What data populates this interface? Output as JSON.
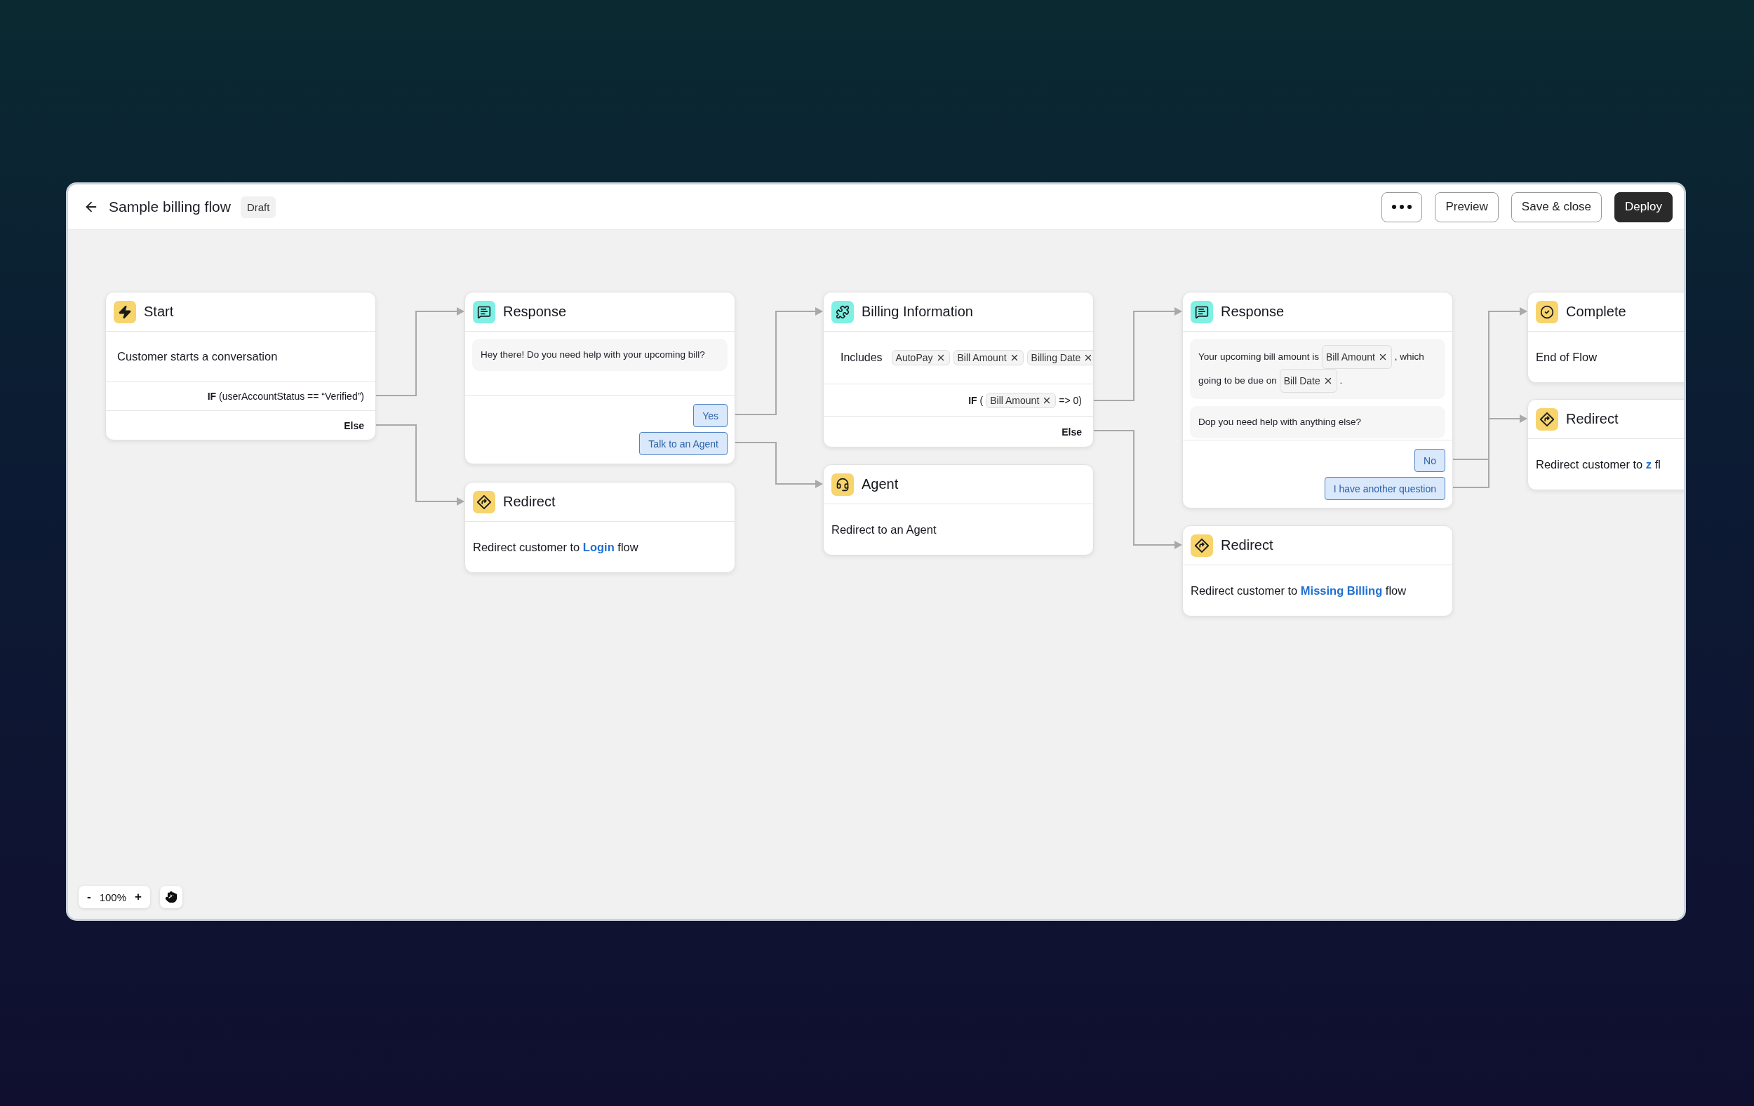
{
  "header": {
    "title": "Sample billing flow",
    "status": "Draft",
    "buttons": [
      {
        "kind": "more"
      },
      {
        "kind": "outline",
        "label": "Preview"
      },
      {
        "kind": "outline",
        "label": "Save & close"
      },
      {
        "kind": "primary",
        "label": "Deploy"
      }
    ]
  },
  "nodes": [
    {
      "kind": "start",
      "title": "Start",
      "body": [
        {
          "kind": "text",
          "text": "Customer starts a conversation"
        }
      ],
      "branches": [
        {
          "kind": "if",
          "parts": [
            {
              "kind": "text",
              "text": "**IF** (userAccountStatus == “Verified”)"
            }
          ]
        },
        {
          "kind": "else",
          "parts": [
            {
              "kind": "text",
              "text": "Else"
            }
          ]
        }
      ]
    },
    {
      "kind": "response",
      "title": "Response",
      "messages": [
        [
          {
            "kind": "text",
            "text": "Hey there! Do you need help with your upcoming bill?"
          }
        ]
      ],
      "replies": [
        "Yes",
        "Talk to an Agent"
      ]
    },
    {
      "kind": "redirect",
      "title": "Redirect",
      "body": [
        {
          "kind": "text",
          "text": "Redirect customer to "
        },
        {
          "kind": "link",
          "text": "Login"
        },
        {
          "kind": "text",
          "text": " flow"
        }
      ]
    },
    {
      "kind": "info",
      "title": "Billing Information",
      "includes": {
        "label": "Includes",
        "tags": [
          "AutoPay",
          "Bill Amount",
          "Billing Date"
        ]
      },
      "branches": [
        {
          "kind": "if",
          "parts": [
            {
              "kind": "text",
              "text": "**IF** ("
            },
            {
              "kind": "tag",
              "text": "Bill Amount"
            },
            {
              "kind": "text",
              "text": "=> 0)"
            }
          ]
        },
        {
          "kind": "else",
          "parts": [
            {
              "kind": "text",
              "text": "Else"
            }
          ]
        }
      ]
    },
    {
      "kind": "agent",
      "title": "Agent",
      "body": [
        {
          "kind": "text",
          "text": "Redirect to an Agent"
        }
      ]
    },
    {
      "kind": "response",
      "title": "Response",
      "messages": [
        [
          {
            "kind": "text",
            "text": "Your upcoming bill amount is"
          },
          {
            "kind": "tag",
            "text": "Bill Amount"
          },
          {
            "kind": "text",
            "text": ", which going to be due on"
          },
          {
            "kind": "tag",
            "text": "Bill Date"
          },
          {
            "kind": "text",
            "text": "."
          }
        ],
        [
          {
            "kind": "text",
            "text": "Dop you need help with anything else?"
          }
        ]
      ],
      "replies": [
        "No",
        "I have another question"
      ]
    },
    {
      "kind": "redirect",
      "title": "Redirect",
      "body": [
        {
          "kind": "text",
          "text": "Redirect customer to "
        },
        {
          "kind": "link",
          "text": "Missing Billing"
        },
        {
          "kind": "text",
          "text": " flow"
        }
      ]
    },
    {
      "kind": "complete",
      "title": "Complete",
      "body": [
        {
          "kind": "text",
          "text": "End of Flow"
        }
      ]
    },
    {
      "kind": "redirect",
      "title": "Redirect",
      "body": [
        {
          "kind": "text",
          "text": "Redirect customer to "
        },
        {
          "kind": "link",
          "text": "z"
        },
        {
          "kind": "text",
          "text": " fl"
        }
      ]
    }
  ],
  "zoom": {
    "minus": "-",
    "value": "100%",
    "plus": "+"
  }
}
